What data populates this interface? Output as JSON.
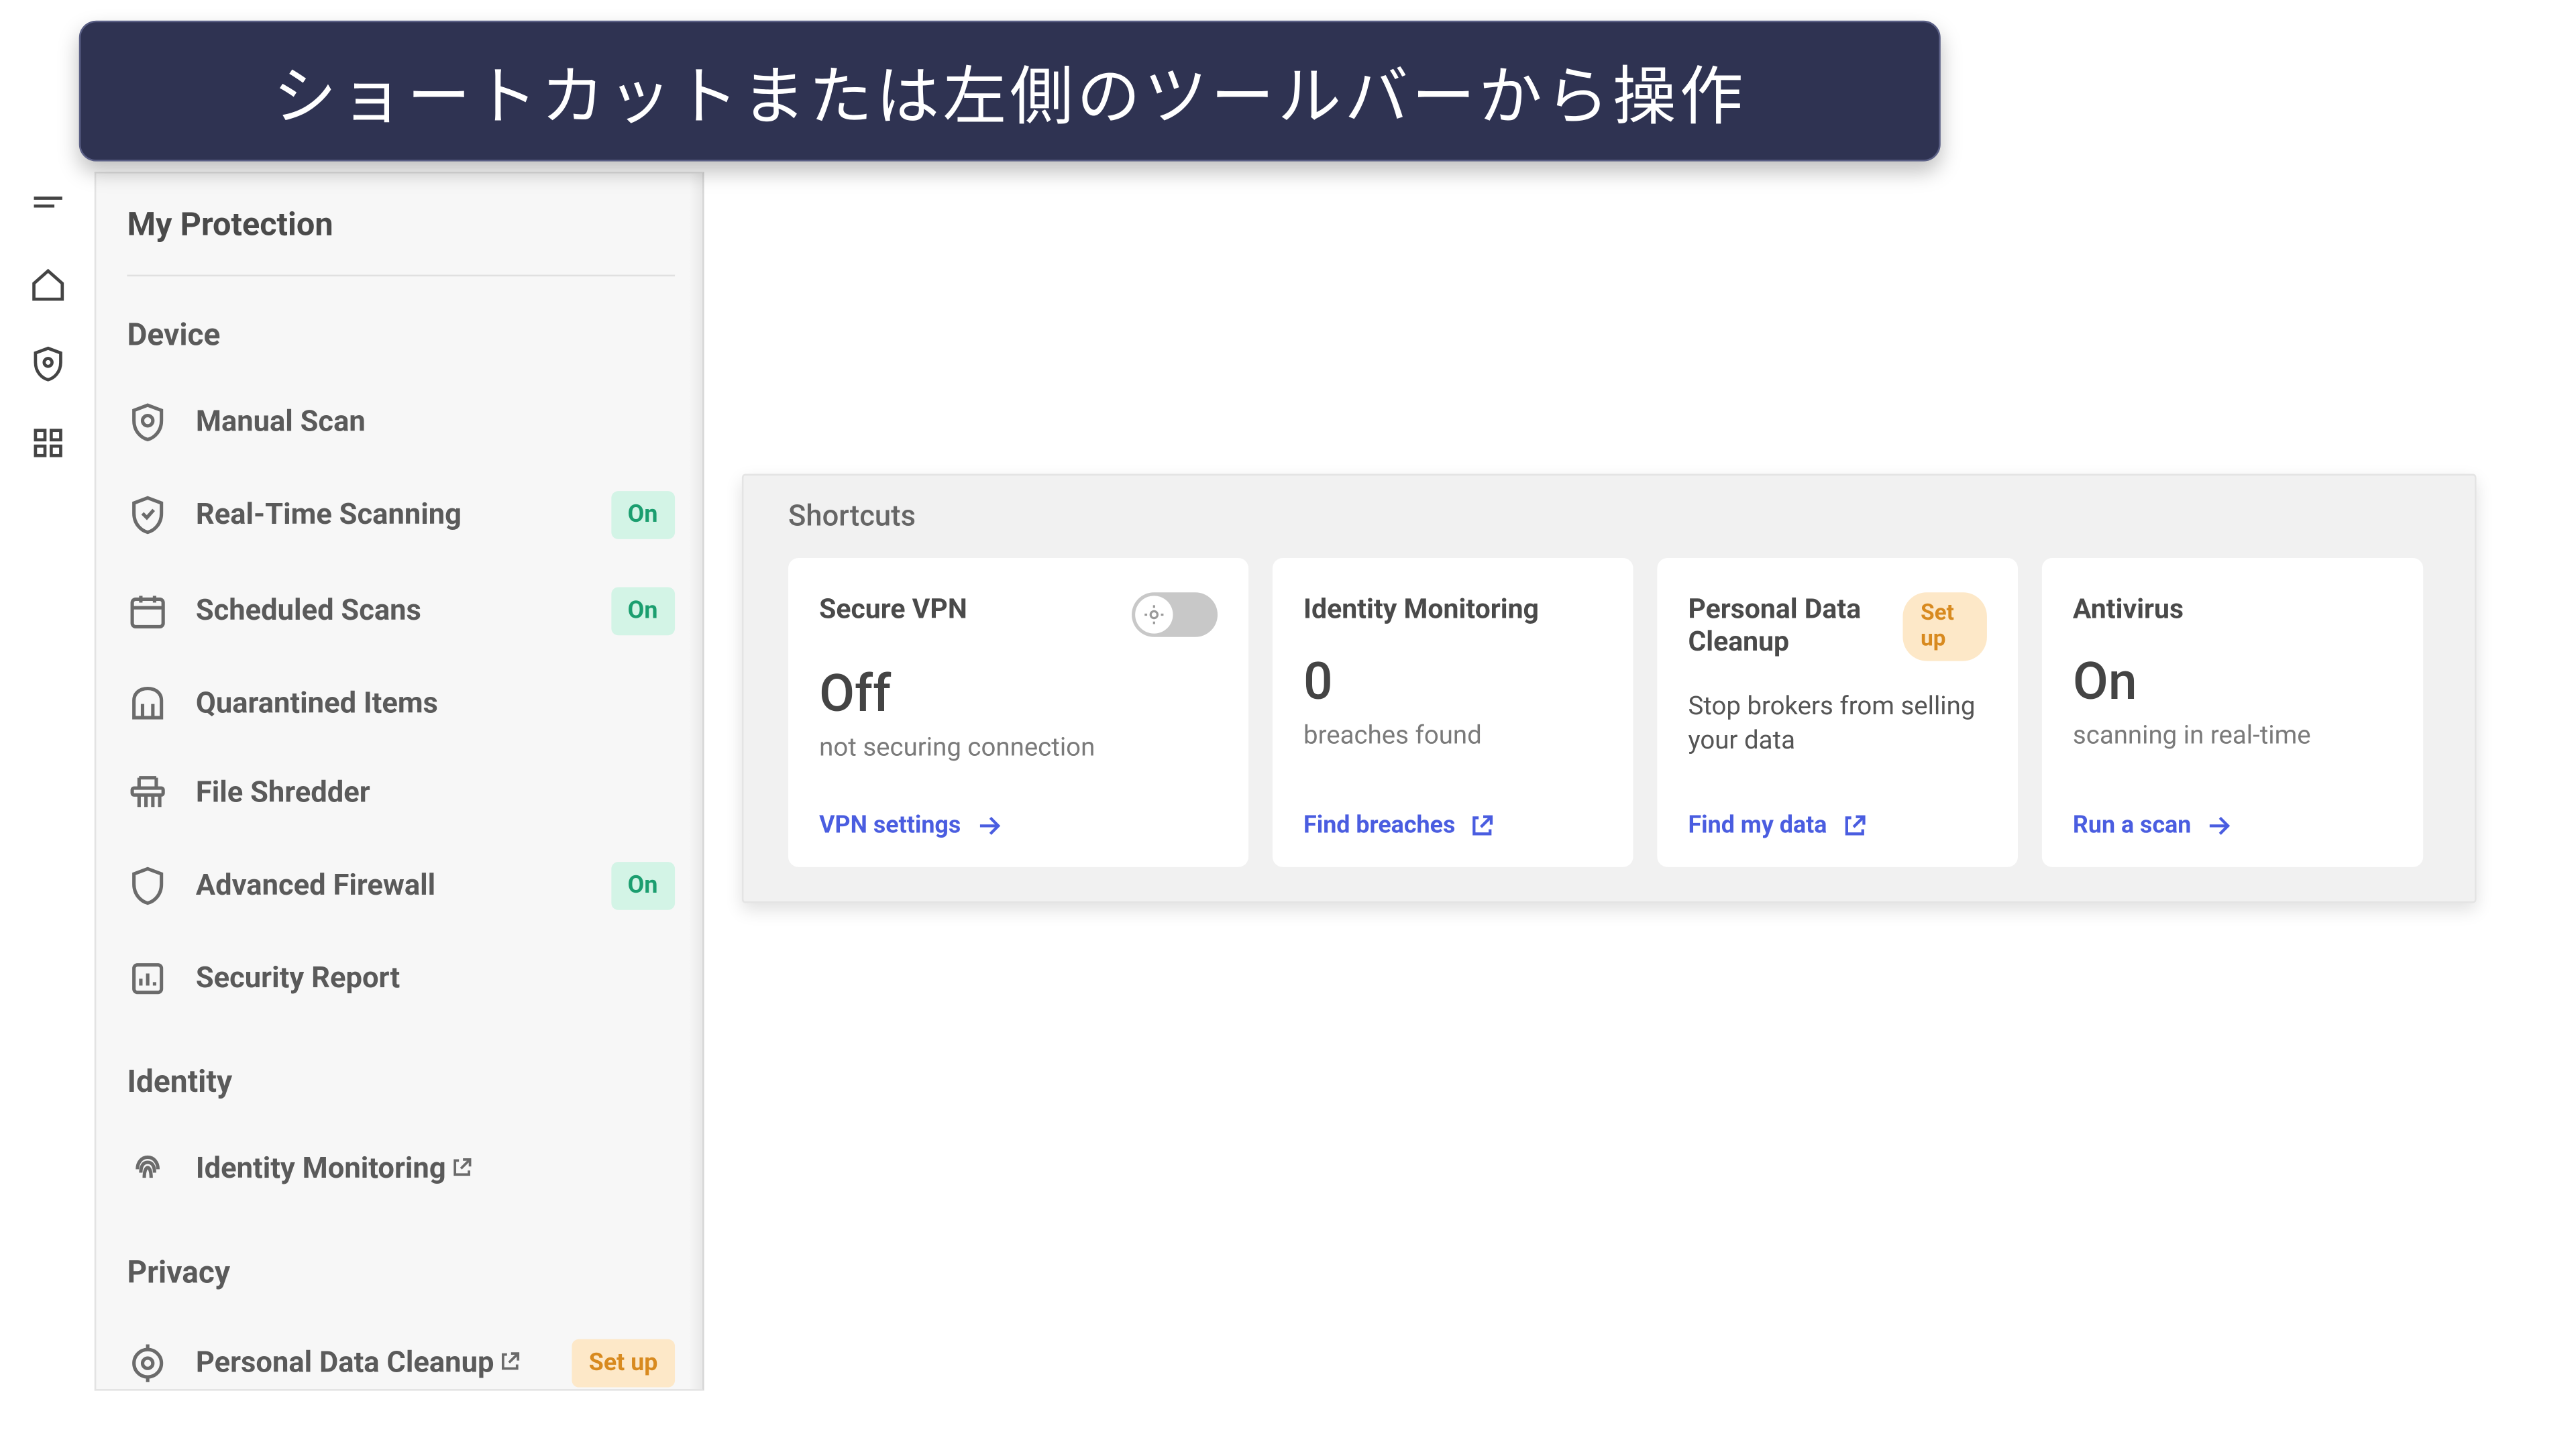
{
  "banner": {
    "text": "ショートカットまたは左側のツールバーから操作"
  },
  "sidebar": {
    "title": "My Protection",
    "sections": {
      "device": {
        "header": "Device",
        "items": [
          {
            "label": "Manual Scan"
          },
          {
            "label": "Real-Time Scanning",
            "badge": "On"
          },
          {
            "label": "Scheduled Scans",
            "badge": "On"
          },
          {
            "label": "Quarantined Items"
          },
          {
            "label": "File Shredder"
          },
          {
            "label": "Advanced Firewall",
            "badge": "On"
          },
          {
            "label": "Security Report"
          }
        ]
      },
      "identity": {
        "header": "Identity",
        "items": [
          {
            "label": "Identity Monitoring"
          }
        ]
      },
      "privacy": {
        "header": "Privacy",
        "items": [
          {
            "label": "Personal Data Cleanup",
            "badge": "Set up"
          }
        ]
      }
    }
  },
  "shortcuts": {
    "title": "Shortcuts",
    "cards": {
      "vpn": {
        "title": "Secure VPN",
        "stat": "Off",
        "sub": "not securing connection",
        "link": "VPN settings",
        "toggle_state": "off"
      },
      "identity": {
        "title": "Identity Monitoring",
        "stat": "0",
        "sub": "breaches found",
        "link": "Find breaches"
      },
      "pdc": {
        "title": "Personal Data Cleanup",
        "badge": "Set up",
        "desc": "Stop brokers from selling your data",
        "link": "Find my data"
      },
      "av": {
        "title": "Antivirus",
        "stat": "On",
        "sub": "scanning in real-time",
        "link": "Run a scan"
      }
    }
  }
}
